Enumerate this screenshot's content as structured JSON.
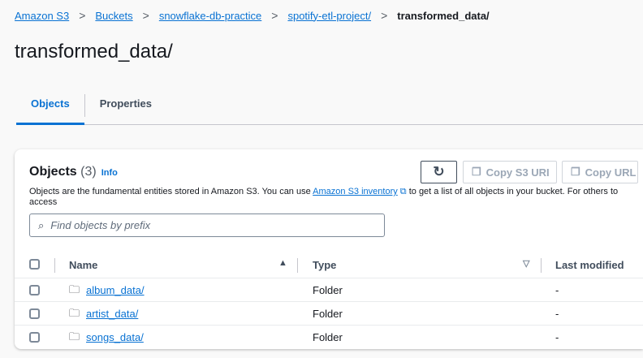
{
  "breadcrumb": [
    "Amazon S3",
    "Buckets",
    "snowflake-db-practice",
    "spotify-etl-project/",
    "transformed_data/"
  ],
  "title": "transformed_data/",
  "tabs": [
    "Objects",
    "Properties"
  ],
  "objects": {
    "title": "Objects",
    "count": "(3)",
    "info": "Info",
    "desc_before": "Objects are the fundamental entities stored in Amazon S3. You can use ",
    "desc_link": "Amazon S3 inventory",
    "desc_after": " to get a list of all objects in your bucket. For others to access",
    "copy_uri": "Copy S3 URI",
    "copy_url": "Copy URL",
    "search_placeholder": "Find objects by prefix",
    "columns": [
      "Name",
      "Type",
      "Last modified"
    ],
    "rows": [
      {
        "name": "album_data/",
        "type": "Folder",
        "modified": "-"
      },
      {
        "name": "artist_data/",
        "type": "Folder",
        "modified": "-"
      },
      {
        "name": "songs_data/",
        "type": "Folder",
        "modified": "-"
      }
    ]
  }
}
